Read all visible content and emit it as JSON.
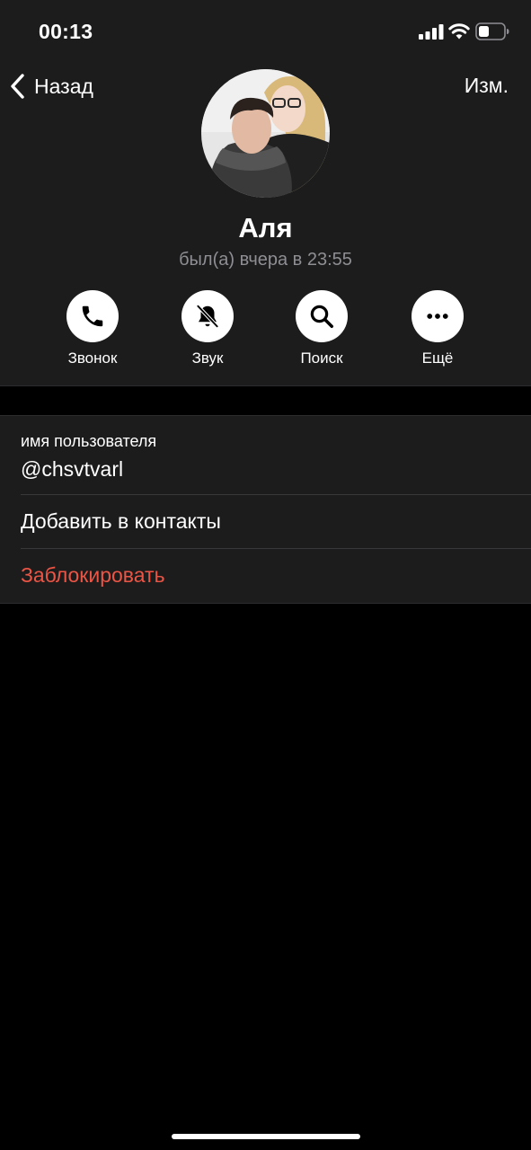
{
  "status_bar": {
    "time": "00:13"
  },
  "nav": {
    "back_label": "Назад",
    "edit_label": "Изм."
  },
  "profile": {
    "name": "Аля",
    "last_seen": "был(а) вчера в 23:55"
  },
  "actions": [
    {
      "label": "Звонок",
      "icon": "phone-icon"
    },
    {
      "label": "Звук",
      "icon": "bell-slash-icon"
    },
    {
      "label": "Поиск",
      "icon": "search-icon"
    },
    {
      "label": "Ещё",
      "icon": "more-icon"
    }
  ],
  "info": {
    "username_caption": "имя пользователя",
    "username": "@chsvtvarl",
    "add_contact": "Добавить в контакты",
    "block": "Заблокировать"
  },
  "colors": {
    "background": "#000000",
    "surface": "#1c1c1d",
    "secondary_text": "#8e8e93",
    "destructive": "#eb5545"
  }
}
